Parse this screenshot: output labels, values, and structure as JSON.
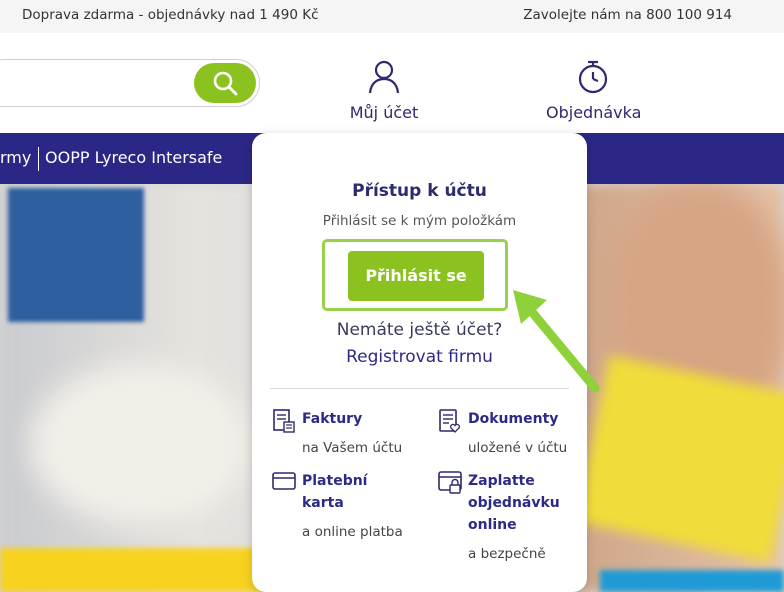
{
  "topbar": {
    "shipping": "Doprava zdarma - objednávky nad 1 490 Kč",
    "phone": "Zavolejte nám na 800 100 914"
  },
  "header": {
    "account_label": "Můj účet",
    "order_label": "Objednávka"
  },
  "nav": {
    "item_partial": "rmy",
    "item_oopp": "OOPP Lyreco Intersafe"
  },
  "popup": {
    "title": "Přístup k účtu",
    "subtitle": "Přihlásit se k mým položkám",
    "login_button": "Přihlásit se",
    "no_account": "Nemáte ještě účet?",
    "register": "Registrovat firmu",
    "features": [
      {
        "title": "Faktury",
        "desc": "na Vašem účtu"
      },
      {
        "title": "Dokumenty",
        "desc": "uložené v účtu"
      },
      {
        "title": "Platební karta",
        "desc": "a online platba"
      },
      {
        "title": "Zaplatte objednávku online",
        "desc": "a bezpečně"
      }
    ]
  },
  "colors": {
    "brand_green": "#8cc21f",
    "nav_blue": "#2b2786",
    "text_navy": "#2d2a6e"
  }
}
